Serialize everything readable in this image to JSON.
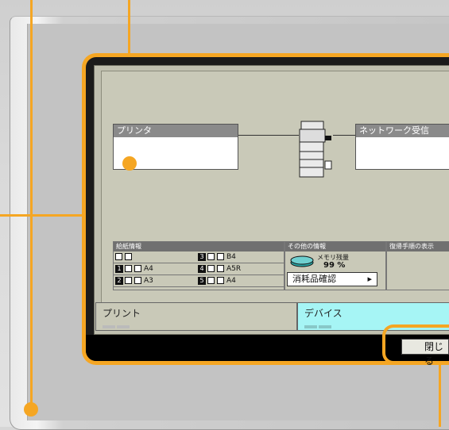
{
  "panels": {
    "printer_title": "プリンタ",
    "network_title": "ネットワーク受信"
  },
  "sections": {
    "paper_info_title": "給紙情報",
    "other_info_title": "その他の情報",
    "recovery_title": "復帰手順の表示",
    "memory_label": "メモリ残量",
    "memory_value": "99 %",
    "consumables_button": "消耗品確認",
    "paper": [
      {
        "slot": "",
        "tray": "",
        "size": ""
      },
      {
        "slot": "3",
        "size": "B4"
      },
      {
        "slot": "1",
        "size": "A4"
      },
      {
        "slot": "4",
        "size": "A5R"
      },
      {
        "slot": "2",
        "size": "A3"
      },
      {
        "slot": "5",
        "size": "A4"
      }
    ]
  },
  "tabs": {
    "print": "プリント",
    "device": "デバイス"
  },
  "close_button": "閉じる",
  "colors": {
    "callout": "#f5a623",
    "device_tab": "#a6f5f5"
  }
}
